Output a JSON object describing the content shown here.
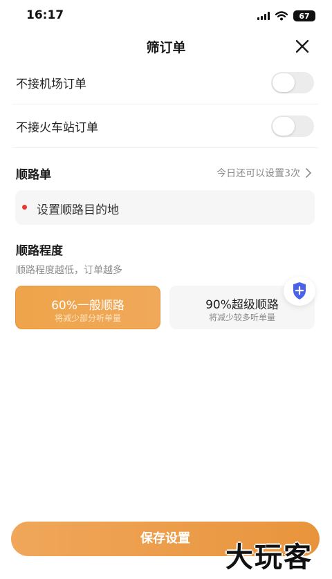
{
  "status_bar": {
    "time": "16:17",
    "battery": "67"
  },
  "header": {
    "title": "筛订单"
  },
  "filters": [
    {
      "label": "不接机场订单",
      "enabled": false
    },
    {
      "label": "不接火车站订单",
      "enabled": false
    }
  ],
  "route": {
    "title": "顺路单",
    "remaining": "今日还可以设置3次",
    "destination_placeholder": "设置顺路目的地"
  },
  "degree": {
    "title": "顺路程度",
    "hint": "顺路程度越低，订单越多",
    "options": [
      {
        "title": "60%一般顺路",
        "subtitle": "将减少部分听单量",
        "selected": true
      },
      {
        "title": "90%超级顺路",
        "subtitle": "将减少较多听单量",
        "selected": false
      }
    ]
  },
  "footer": {
    "save_label": "保存设置"
  },
  "watermark": "大玩客",
  "colors": {
    "accent": "#EDA14C",
    "dot": "#E53935",
    "shield": "#4B63E6"
  }
}
